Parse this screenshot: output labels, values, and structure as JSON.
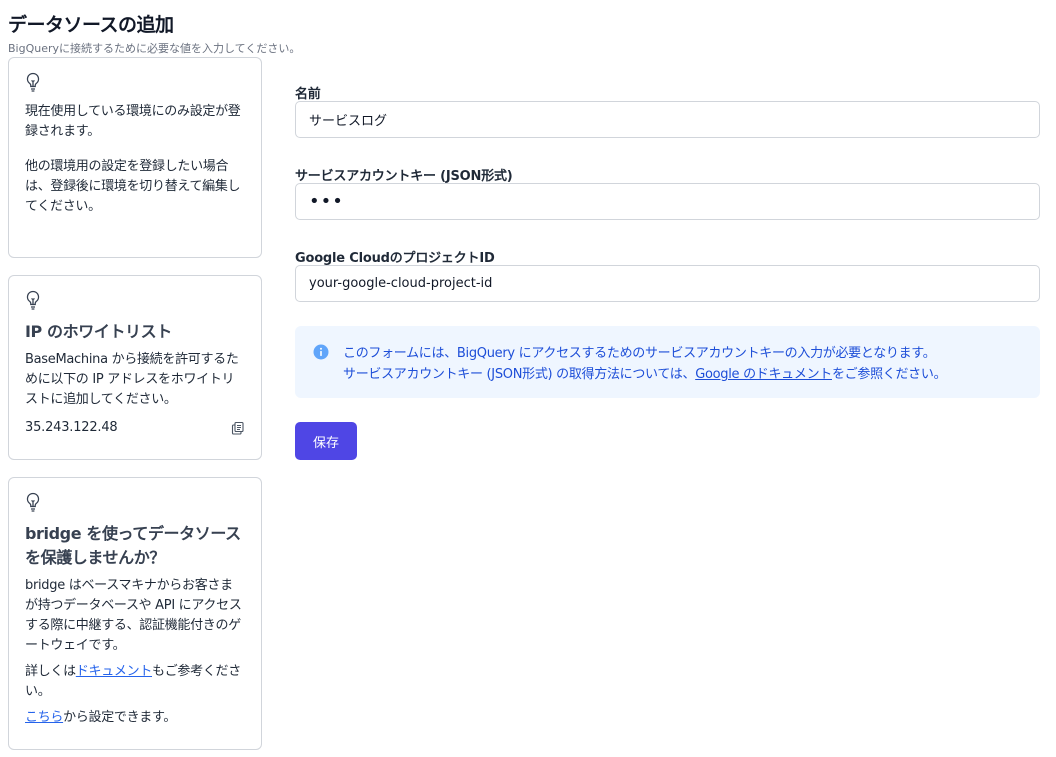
{
  "page": {
    "title": "データソースの追加",
    "subtitle": "BigQueryに接続するために必要な値を入力してください。"
  },
  "sidebar": {
    "env_card": {
      "icon": "lightbulb-icon",
      "paragraph1": "現在使用している環境にのみ設定が登録されます。",
      "paragraph2": "他の環境用の設定を登録したい場合は、登録後に環境を切り替えて編集してください。"
    },
    "ip_card": {
      "icon": "lightbulb-icon",
      "title": "IP のホワイトリスト",
      "text": "BaseMachina から接続を許可するために以下の IP アドレスをホワイトリストに追加してください。",
      "ip": "35.243.122.48",
      "copy_icon": "copy-icon"
    },
    "bridge_card": {
      "icon": "lightbulb-icon",
      "title": "bridge を使ってデータソースを保護しませんか？",
      "text": "bridge はベースマキナからお客さまが持つデータベースや API にアクセスする際に中継する、認証機能付きのゲートウェイです。",
      "doc_prefix": "詳しくは",
      "doc_link": "ドキュメント",
      "doc_suffix": "もご参考ください。",
      "setup_link": "こちら",
      "setup_suffix": "から設定できます。"
    }
  },
  "form": {
    "name_label": "名前",
    "name_value": "サービスログ",
    "key_label": "サービスアカウントキー (JSON形式)",
    "key_value": "•••",
    "project_label": "Google CloudのプロジェクトID",
    "project_value": "your-google-cloud-project-id",
    "info": {
      "icon": "info-icon",
      "line1": "このフォームには、BigQuery にアクセスするためのサービスアカウントキーの入力が必要となります。",
      "line2_prefix": "サービスアカウントキー (JSON形式) の取得方法については、",
      "line2_link": "Google のドキュメント",
      "line2_suffix": "をご参照ください。"
    },
    "save_label": "保存"
  },
  "colors": {
    "primary": "#4f46e5",
    "info_bg": "#eff6ff",
    "info_text": "#1d4ed8",
    "link": "#2563eb",
    "border": "#d1d5db"
  }
}
